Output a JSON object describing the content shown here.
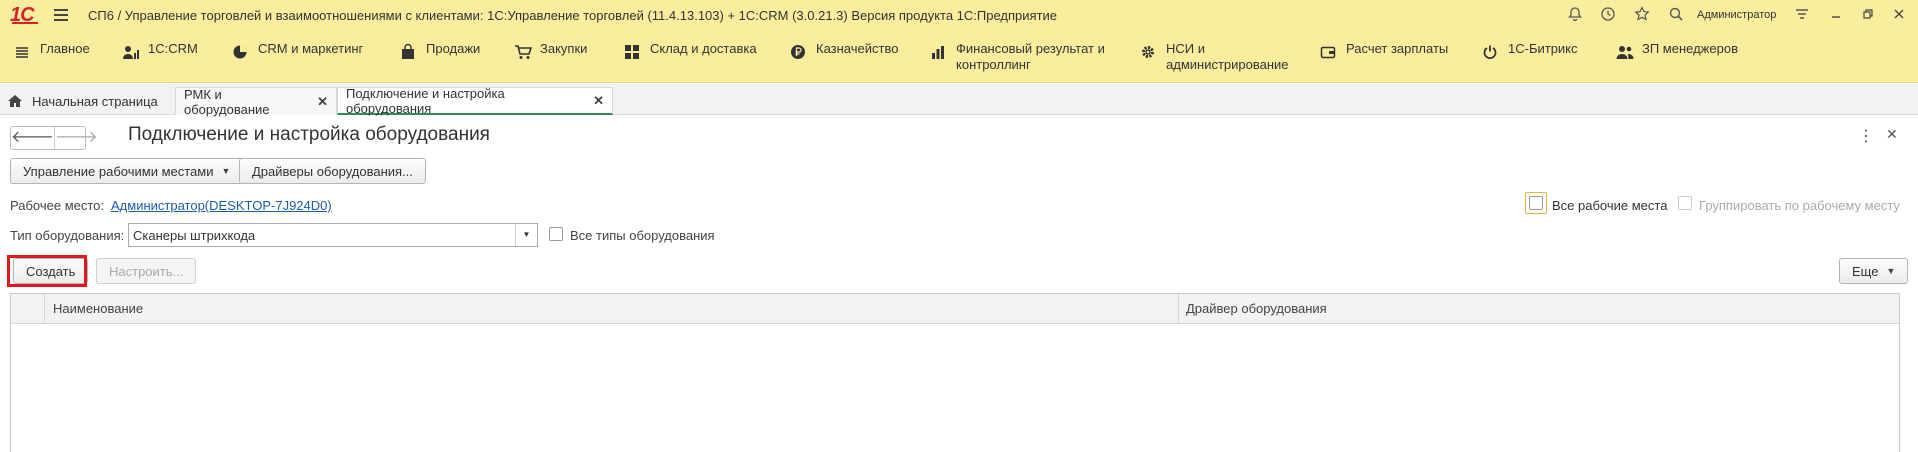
{
  "app": {
    "title": "СП6 / Управление торговлей и взаимоотношениями с клиентами: 1С:Управление торговлей (11.4.13.103) + 1С:CRM (3.0.21.3) Версия продукта 1С:Предприятие",
    "logo": "1С",
    "user": "Администратор",
    "brand_color": "#fbed9e"
  },
  "sections": [
    {
      "label": "Главное",
      "icon": "menu-lines-icon"
    },
    {
      "label": "1С:CRM",
      "icon": "person-chart-icon"
    },
    {
      "label": "CRM и маркетинг",
      "icon": "pie-chart-icon"
    },
    {
      "label": "Продажи",
      "icon": "bag-icon"
    },
    {
      "label": "Закупки",
      "icon": "cart-icon"
    },
    {
      "label": "Склад и доставка",
      "icon": "grid-icon"
    },
    {
      "label": "Казначейство",
      "icon": "ruble-coin-icon"
    },
    {
      "label": "Финансовый результат и контроллинг",
      "icon": "bar-chart-icon"
    },
    {
      "label": "НСИ и администрирование",
      "icon": "gear-icon"
    },
    {
      "label": "Расчет зарплаты",
      "icon": "wallet-icon"
    },
    {
      "label": "1С-Битрикс",
      "icon": "power-icon"
    },
    {
      "label": "ЗП менеджеров",
      "icon": "people-icon"
    }
  ],
  "tabs": {
    "home": "Начальная страница",
    "tab2": "РМК и оборудование",
    "tab3": "Подключение и настройка оборудования"
  },
  "form": {
    "title": "Подключение и настройка оборудования",
    "manage_workplaces": "Управление рабочими местами",
    "drivers": "Драйверы оборудования...",
    "workplace_label": "Рабочее место:",
    "workplace_value": "Администратор(DESKTOP-7J924D0)",
    "all_workplaces": "Все рабочие места",
    "group_by_workplace": "Группировать по рабочему месту",
    "equipment_type_label": "Тип оборудования:",
    "equipment_type_value": "Сканеры штрихкода",
    "all_equipment_types": "Все типы оборудования",
    "create": "Создать",
    "configure": "Настроить...",
    "more": "Еще",
    "highlight_color": "#e0181f"
  },
  "table": {
    "columns": [
      "Наименование",
      "Драйвер оборудования"
    ],
    "rows": []
  }
}
